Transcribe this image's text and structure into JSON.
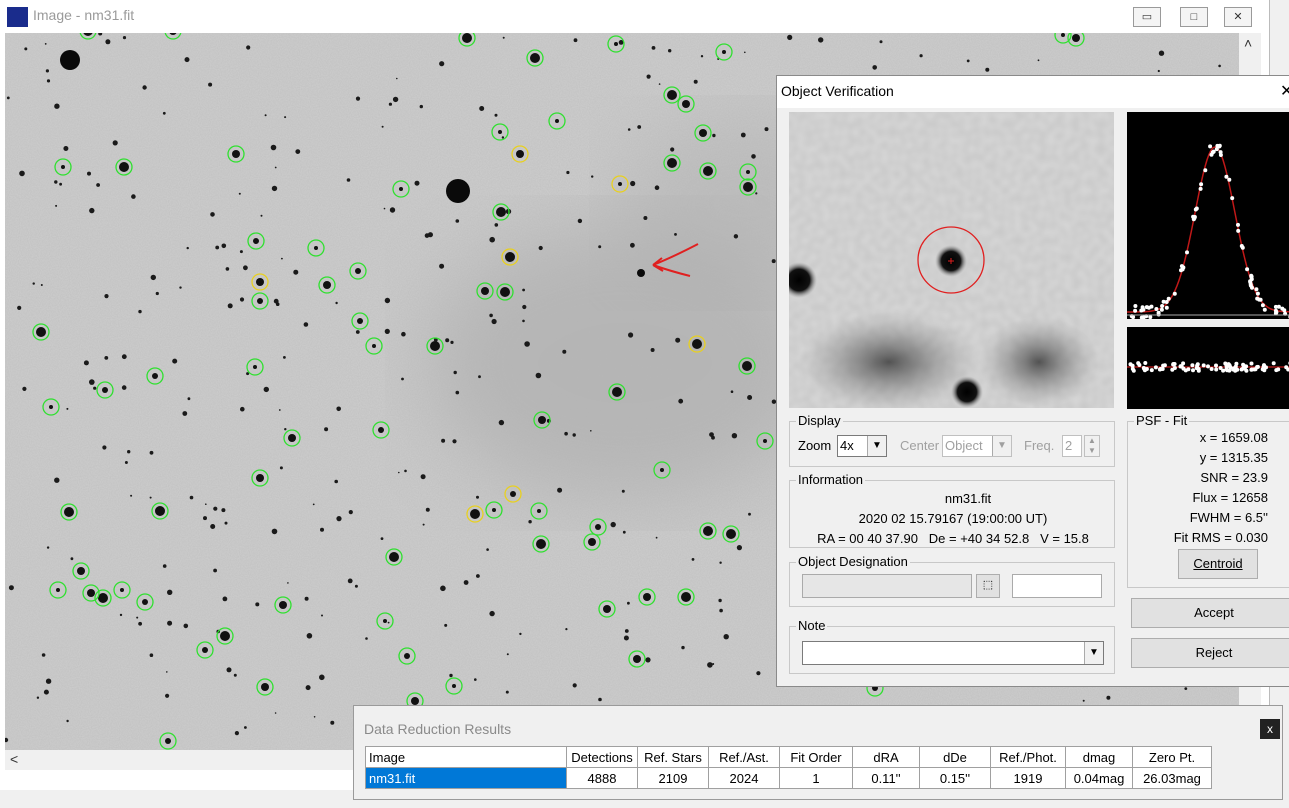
{
  "image_window": {
    "title": "Image - nm31.fit",
    "minimize": "▭",
    "maximize": "□",
    "close": "✕",
    "scroll_up": "˄",
    "scroll_left": "<"
  },
  "object_verification": {
    "title": "Object Verification",
    "close": "✕",
    "display": {
      "group_label": "Display",
      "zoom_label": "Zoom",
      "zoom_value": "4x",
      "center_label": "Center",
      "center_value": "Object",
      "freq_label": "Freq.",
      "freq_value": "2"
    },
    "information": {
      "group_label": "Information",
      "filename": "nm31.fit",
      "datetime": "2020 02 15.79167 (19:00:00 UT)",
      "coords": "RA = 00 40 37.90   De = +40 34 52.8   V = 15.8"
    },
    "designation": {
      "group_label": "Object Designation",
      "value": "",
      "second_value": ""
    },
    "note": {
      "group_label": "Note",
      "value": ""
    },
    "psf_fit": {
      "group_label": "PSF - Fit",
      "x": "x = 1659.08",
      "y": "y = 1315.35",
      "snr": "SNR = 23.9",
      "flux": "Flux = 12658",
      "fwhm": "FWHM = 6.5''",
      "fit_rms": "Fit RMS = 0.030",
      "centroid_label": "Centroid"
    },
    "accept_label": "Accept",
    "reject_label": "Reject"
  },
  "data_reduction": {
    "title": "Data Reduction Results",
    "close": "x",
    "columns": [
      "Image",
      "Detections",
      "Ref. Stars",
      "Ref./Ast.",
      "Fit Order",
      "dRA",
      "dDe",
      "Ref./Phot.",
      "dmag",
      "Zero Pt."
    ],
    "rows": [
      [
        "nm31.fit",
        "4888",
        "2109",
        "2024",
        "1",
        "0.11''",
        "0.15''",
        "1919",
        "0.04mag",
        "26.03mag"
      ]
    ]
  },
  "colors": {
    "detection_circle": "#2fe02f",
    "candidate_circle": "#e8d020",
    "annotation_arrow": "#e02020",
    "selection": "#0078d7"
  }
}
